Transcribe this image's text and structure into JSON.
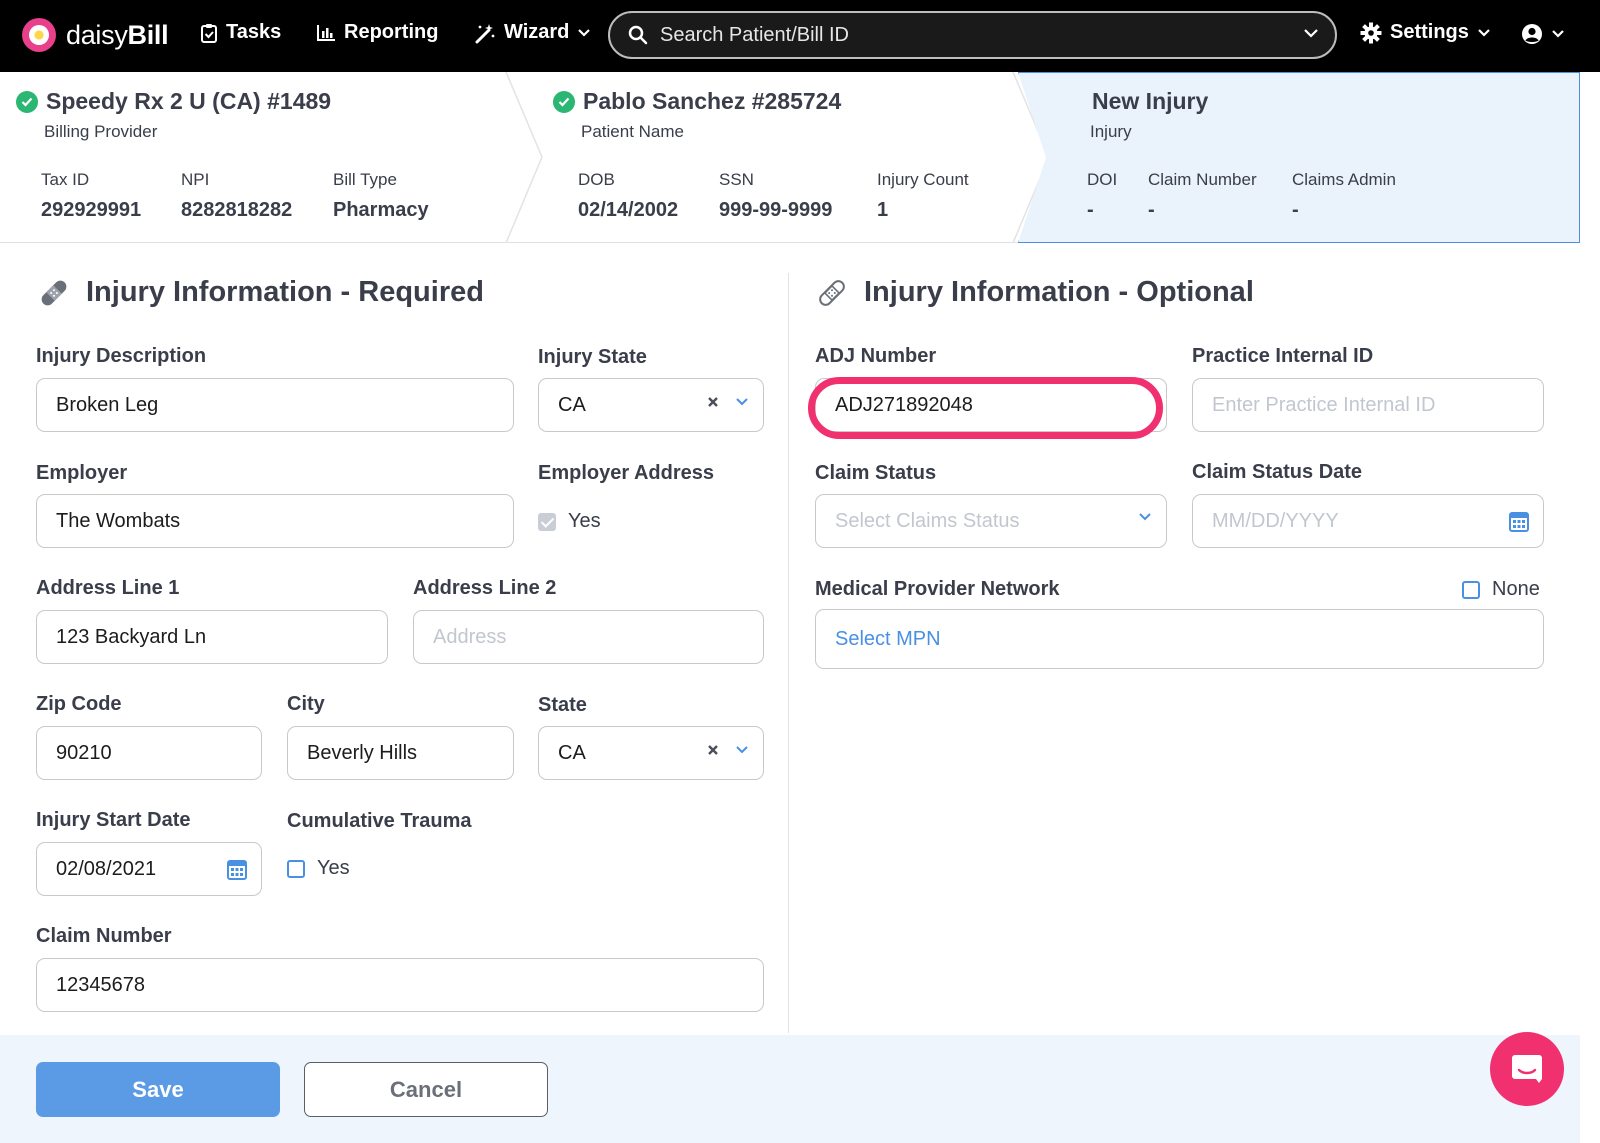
{
  "nav": {
    "brand_light": "daisy",
    "brand_bold": "Bill",
    "tasks": "Tasks",
    "reporting": "Reporting",
    "wizard": "Wizard",
    "search_placeholder": "Search Patient/Bill ID",
    "settings": "Settings"
  },
  "crumbs": {
    "provider": {
      "title": "Speedy Rx 2 U (CA) #1489",
      "subtitle": "Billing Provider",
      "fields": [
        {
          "k": "Tax ID",
          "v": "292929991"
        },
        {
          "k": "NPI",
          "v": "8282818282"
        },
        {
          "k": "Bill Type",
          "v": "Pharmacy"
        }
      ]
    },
    "patient": {
      "title": "Pablo Sanchez #285724",
      "subtitle": "Patient Name",
      "fields": [
        {
          "k": "DOB",
          "v": "02/14/2002"
        },
        {
          "k": "SSN",
          "v": "999-99-9999"
        },
        {
          "k": "Injury Count",
          "v": "1"
        }
      ]
    },
    "injury": {
      "title": "New Injury",
      "subtitle": "Injury",
      "fields": [
        {
          "k": "DOI",
          "v": "-"
        },
        {
          "k": "Claim Number",
          "v": "-"
        },
        {
          "k": "Claims Admin",
          "v": "-"
        }
      ]
    }
  },
  "required": {
    "title": "Injury Information - Required",
    "injury_description": {
      "label": "Injury Description",
      "value": "Broken Leg"
    },
    "injury_state": {
      "label": "Injury State",
      "value": "CA"
    },
    "employer": {
      "label": "Employer",
      "value": "The Wombats"
    },
    "employer_address": {
      "label": "Employer Address",
      "option": "Yes",
      "checked": true
    },
    "address1": {
      "label": "Address Line 1",
      "value": "123 Backyard Ln"
    },
    "address2": {
      "label": "Address Line 2",
      "placeholder": "Address"
    },
    "zip": {
      "label": "Zip Code",
      "value": "90210"
    },
    "city": {
      "label": "City",
      "value": "Beverly Hills"
    },
    "state": {
      "label": "State",
      "value": "CA"
    },
    "start_date": {
      "label": "Injury Start Date",
      "value": "02/08/2021"
    },
    "cumulative": {
      "label": "Cumulative Trauma",
      "option": "Yes",
      "checked": false
    },
    "claim_number": {
      "label": "Claim Number",
      "value": "12345678"
    }
  },
  "optional": {
    "title": "Injury Information - Optional",
    "adj": {
      "label": "ADJ Number",
      "value": "ADJ271892048"
    },
    "practice_id": {
      "label": "Practice Internal ID",
      "placeholder": "Enter Practice Internal ID"
    },
    "claim_status": {
      "label": "Claim Status",
      "placeholder": "Select Claims Status"
    },
    "claim_status_date": {
      "label": "Claim Status Date",
      "placeholder": "MM/DD/YYYY"
    },
    "mpn": {
      "label": "Medical Provider Network",
      "none_label": "None",
      "value": "Select MPN"
    }
  },
  "footer": {
    "save": "Save",
    "cancel": "Cancel"
  },
  "colors": {
    "accent": "#4a90e2",
    "highlight": "#f0306f",
    "success": "#2bb673"
  }
}
